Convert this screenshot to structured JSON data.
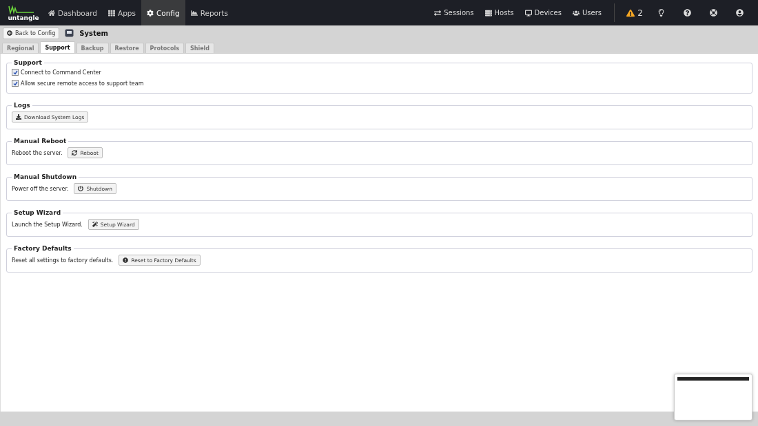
{
  "nav": {
    "logo": "untangle",
    "items": [
      {
        "label": "Dashboard",
        "selected": false
      },
      {
        "label": "Apps",
        "selected": false
      },
      {
        "label": "Config",
        "selected": true
      },
      {
        "label": "Reports",
        "selected": false
      }
    ],
    "right_items": [
      {
        "label": "Sessions"
      },
      {
        "label": "Hosts"
      },
      {
        "label": "Devices"
      },
      {
        "label": "Users"
      }
    ],
    "alerts": "2"
  },
  "header": {
    "back_button": "Back to Config",
    "title": "System"
  },
  "tabs": [
    {
      "label": "Regional",
      "selected": false
    },
    {
      "label": "Support",
      "selected": true
    },
    {
      "label": "Backup",
      "selected": false
    },
    {
      "label": "Restore",
      "selected": false
    },
    {
      "label": "Protocols",
      "selected": false
    },
    {
      "label": "Shield",
      "selected": false
    }
  ],
  "sections": [
    {
      "kind": "checkboxes",
      "title": "Support",
      "options": [
        {
          "label": "Connect to Command Center",
          "checked": true
        },
        {
          "label": "Allow secure remote access to support team",
          "checked": true
        }
      ]
    },
    {
      "kind": "action",
      "title": "Logs",
      "button": "Download System Logs"
    },
    {
      "kind": "action",
      "title": "Manual Reboot",
      "text": "Reboot the server.",
      "button": "Reboot"
    },
    {
      "kind": "action",
      "title": "Manual Shutdown",
      "text": "Power off the server.",
      "button": "Shutdown"
    },
    {
      "kind": "action",
      "title": "Setup Wizard",
      "text": "Launch the Setup Wizard.",
      "button": "Setup Wizard"
    },
    {
      "kind": "action",
      "title": "Factory Defaults",
      "text": "Reset all settings to factory defaults.",
      "button": "Reset to Factory Defaults"
    }
  ]
}
